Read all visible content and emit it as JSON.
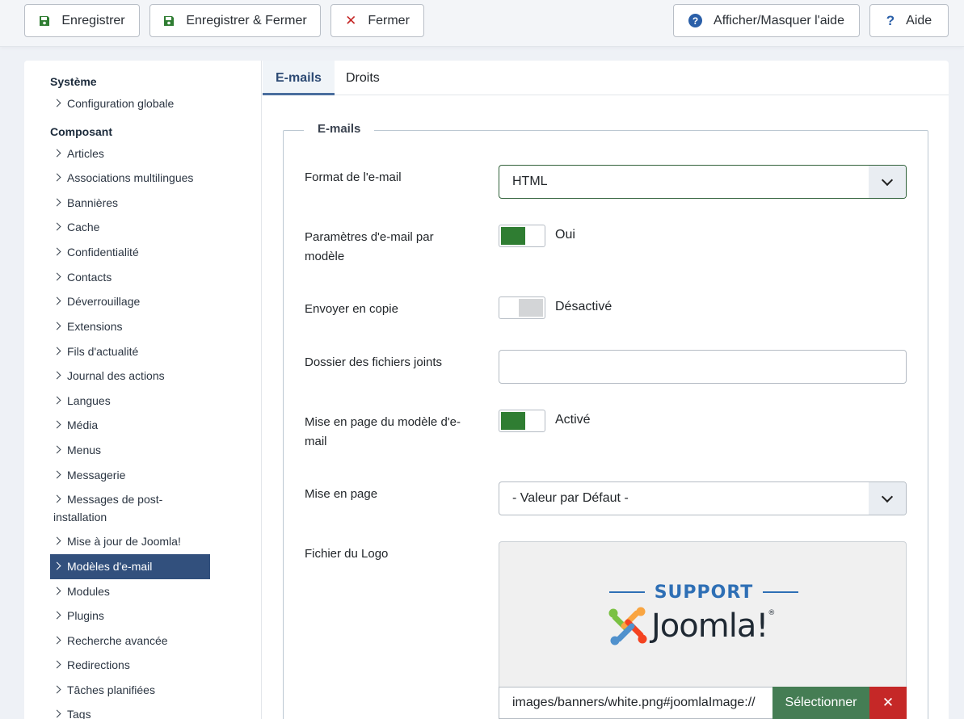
{
  "toolbar": {
    "save": "Enregistrer",
    "save_close": "Enregistrer & Fermer",
    "close": "Fermer",
    "toggle_help": "Afficher/Masquer l'aide",
    "help": "Aide"
  },
  "sidebar": {
    "system_heading": "Système",
    "system_items": [
      "Configuration globale"
    ],
    "component_heading": "Composant",
    "component_items": [
      "Articles",
      "Associations multilingues",
      "Bannières",
      "Cache",
      "Confidentialité",
      "Contacts",
      "Déverrouillage",
      "Extensions",
      "Fils d'actualité",
      "Journal des actions",
      "Langues",
      "Média",
      "Menus",
      "Messagerie",
      "Messages de post-",
      "installation",
      "Mise à jour de Joomla!",
      "Modèles d'e-mail",
      "Modules",
      "Plugins",
      "Recherche avancée",
      "Redirections",
      "Tâches planifiées",
      "Tags"
    ],
    "active_item": "Modèles d'e-mail"
  },
  "tabs": [
    "E-mails",
    "Droits"
  ],
  "form": {
    "legend": "E-mails",
    "format_label": "Format de l'e-mail",
    "format_value": "HTML",
    "per_template_label_1": "Paramètres d'e-mail par",
    "per_template_label_2": "modèle",
    "per_template_state": "Oui",
    "send_copy_label": "Envoyer en copie",
    "send_copy_state": "Désactivé",
    "attachments_label": "Dossier des fichiers joints",
    "attachments_value": "",
    "layout_label_1": "Mise en page du modèle d'e-",
    "layout_label_2": "mail",
    "layout_state": "Activé",
    "layout_select_label": "Mise en page",
    "layout_select_value": "- Valeur par Défaut -",
    "logo_label": "Fichier du Logo",
    "logo_support_text": "SUPPORT",
    "logo_word": "Joomla!",
    "logo_reg": "®",
    "logo_path": "images/banners/white.png#joomlaImage://",
    "select_button": "Sélectionner",
    "clear_button": "✕"
  },
  "colors": {
    "toggle_on": "#2f7d32",
    "active_nav": "#32507d",
    "select_button": "#457d54",
    "clear_button": "#c52827",
    "brand_blue": "#2e6fb5"
  }
}
